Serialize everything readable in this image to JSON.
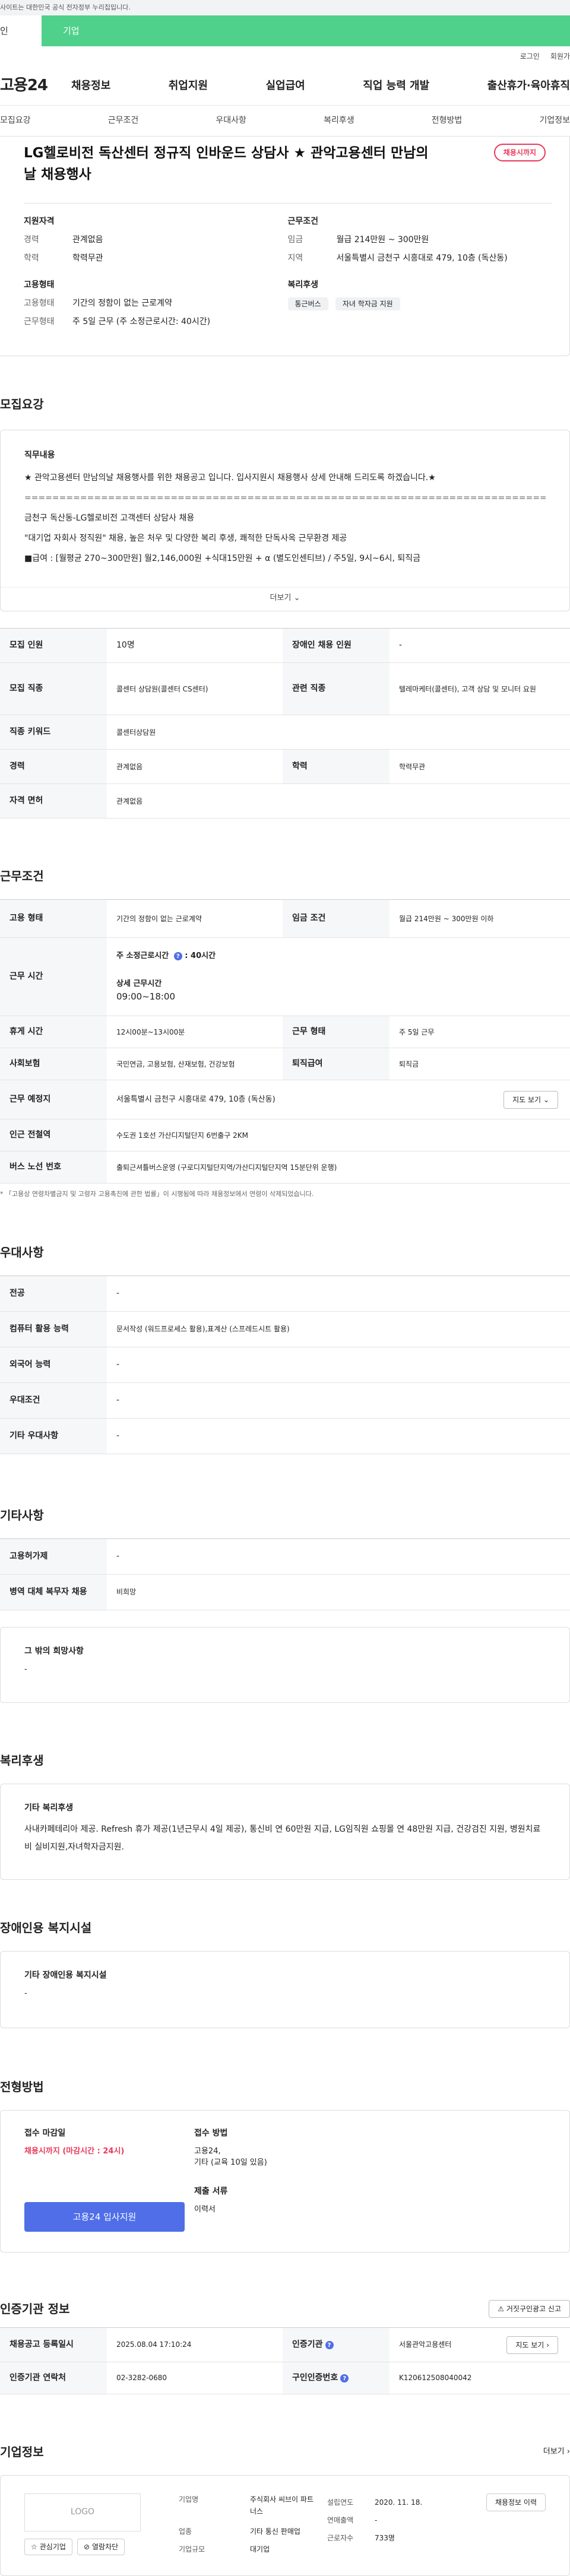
{
  "top_notice": "사이트는 대한민국 공식 전자정부 누리집입니다.",
  "user_tabs": {
    "personal": "인",
    "company": "기업"
  },
  "util": {
    "login": "로그인",
    "signup": "회원가"
  },
  "logo": "고용24",
  "gnb": [
    "채용정보",
    "취업지원",
    "실업급여",
    "직업 능력 개발",
    "출산휴가·육아휴직"
  ],
  "subnav": [
    "모집요강",
    "근무조건",
    "우대사항",
    "복리후생",
    "전형방법",
    "기업정보"
  ],
  "job": {
    "title": "LG헬로비전 독산센터 정규직 인바운드 상담사 ★ 관악고용센터 만남의날 채용행사",
    "status_badge": "채용시까지",
    "qual_title": "지원자격",
    "qual": [
      {
        "k": "경력",
        "v": "관계없음"
      },
      {
        "k": "학력",
        "v": "학력무관"
      }
    ],
    "cond_title": "근무조건",
    "cond": [
      {
        "k": "임금",
        "v": "월급 214만원 ~ 300만원"
      },
      {
        "k": "지역",
        "v": "서울특별시 금천구 시흥대로 479, 10층 (독산동)"
      }
    ],
    "emp_title": "고용형태",
    "emp": [
      {
        "k": "고용형태",
        "v": "기간의 정함이 없는 근로계약"
      },
      {
        "k": "근무형태",
        "v": "주 5일 근무 (주 소정근로시간: 40시간)"
      }
    ],
    "welfare_title": "복리후생",
    "welfare_chips": [
      "통근버스",
      "자녀 학자금 지원"
    ]
  },
  "recruit": {
    "heading": "모집요강",
    "desc_title": "직무내용",
    "lines": [
      "★ 관악고용센터 만남의날 채용행사를 위한 채용공고 입니다. 입사지원시 채용행사 상세 안내해 드리도록 하겠습니다.★",
      "==============================================================================",
      "금천구 독산동-LG헬로비전 고객센터 상담사 채용",
      "\"대기업 자회사 정직원\" 채용, 높은 처우 및 다양한 복리 후생, 쾌적한 단독사옥 근무환경 제공",
      "■급여 : [월평균 270~300만원] 월2,146,000원 +식대15만원 + α (별도인센티브) / 주5일, 9시~6시, 퇴직금"
    ],
    "more": "더보기",
    "table": [
      {
        "k1": "모집 인원",
        "v1": "10명",
        "k2": "장애인 채용 인원",
        "v2": "-"
      },
      {
        "k1": "모집 직종",
        "v1": "콜센터 상담원(콜센터 CS센터)",
        "k2": "관련 직종",
        "v2": "텔레마케터(콜센터), 고객 상담 및 모니터 요원"
      },
      {
        "k1": "직종 키워드",
        "v1": "콜센터상담원"
      },
      {
        "k1": "경력",
        "v1": "관계없음",
        "k2": "학력",
        "v2": "학력무관"
      },
      {
        "k1": "자격 면허",
        "v1": "관계없음"
      }
    ]
  },
  "work": {
    "heading": "근무조건",
    "emp_type_k": "고용 형태",
    "emp_type_v": "기간의 정함이 없는 근로계약",
    "wage_k": "임금 조건",
    "wage_v": "월급 214만원 ~ 300만원 이하",
    "hours_k": "근무 시간",
    "hours_title": "주 소정근로시간",
    "hours_value": "40시간",
    "detail_title": "상세 근무시간",
    "detail_value": "09:00~18:00",
    "break_k": "휴게 시간",
    "break_v": "12시00분~13시00분",
    "form_k": "근무 형태",
    "form_v": "주 5일 근무",
    "ins_k": "사회보험",
    "ins_v": "국민연금, 고용보험, 산재보험, 건강보험",
    "ret_k": "퇴직급여",
    "ret_v": "퇴직금",
    "loc_k": "근무 예정지",
    "loc_v": "서울특별시 금천구 시흥대로 479, 10층 (독산동)",
    "map_btn": "지도 보기",
    "sub_k": "인근 전철역",
    "sub_v": "수도권 1호선 가산디지털단지 6번출구 2KM",
    "bus_k": "버스 노선 번호",
    "bus_v": "출퇴근셔틀버스운영 (구로디지털단지역/가산디지털단지역 15분단위 운행)",
    "note": "* 「고용상 연령차별금지 및 고령자 고용촉진에 관한 법률」이 시행됨에 따라 채용정보에서 연령이 삭제되었습니다."
  },
  "pref": {
    "heading": "우대사항",
    "rows": [
      {
        "k": "전공",
        "v": "-"
      },
      {
        "k": "컴퓨터 활용 능력",
        "v": "문서작성 (워드프로세스 활용),표계산 (스프레드시트 활용)"
      },
      {
        "k": "외국어 능력",
        "v": "-"
      },
      {
        "k": "우대조건",
        "v": "-"
      },
      {
        "k": "기타 우대사항",
        "v": "-"
      }
    ]
  },
  "other": {
    "heading": "기타사항",
    "rows": [
      {
        "k": "고용허가제",
        "v": "-"
      },
      {
        "k": "병역 대체 복무자 채용",
        "v": "비희망"
      }
    ],
    "box_title": "그 밖의 희망사항",
    "box_value": "-"
  },
  "welfare": {
    "heading": "복리후생",
    "title": "기타 복리후생",
    "text": "사내카페테리아 제공.  Refresh 휴가 제공(1년근무시 4일 제공), 통신비 연 60만원 지급, LG임직원 쇼핑몰 연 48만원 지급, 건강검진 지원, 병원치료비 실비지원,자녀학자금지원."
  },
  "disabled": {
    "heading": "장애인용 복지시설",
    "title": "기타 장애인용 복지시설",
    "value": "-"
  },
  "process": {
    "heading": "전형방법",
    "deadline_title": "접수 마감일",
    "deadline_value": "채용시까지 (마감시간 : 24시)",
    "method_title": "접수 방법",
    "method_lines": [
      "고용24,",
      "기타 (교육 10일 있음)"
    ],
    "docs_title": "제출 서류",
    "docs_value": "이력서",
    "apply_btn": "고용24 입사지원"
  },
  "cert": {
    "heading": "인증기관 정보",
    "report_btn": "거짓구인광고 신고",
    "reg_k": "채용공고 등록일시",
    "reg_v": "2025.08.04 17:10:24",
    "org_k": "인증기관",
    "org_v": "서울관악고용센터",
    "map_btn": "지도 보기",
    "tel_k": "인증기관 연락처",
    "tel_v": "02-3282-0680",
    "num_k": "구인인증번호",
    "num_v": "K120612508040042"
  },
  "company": {
    "heading": "기업정보",
    "more": "더보기",
    "logo": "LOGO",
    "fav_btn": "관심기업",
    "block_btn": "열람차단",
    "name_k": "기업명",
    "name_v": "주식회사 씨브이 파트너스",
    "est_k": "설립연도",
    "est_v": "2020. 11. 18.",
    "sales_k": "연매출액",
    "sales_v": "-",
    "ind_k": "업종",
    "ind_v": "기타 통신 판매업",
    "emp_k": "근로자수",
    "emp_v": "733명",
    "size_k": "기업규모",
    "size_v": "대기업",
    "history_btn": "채용정보 이력"
  }
}
